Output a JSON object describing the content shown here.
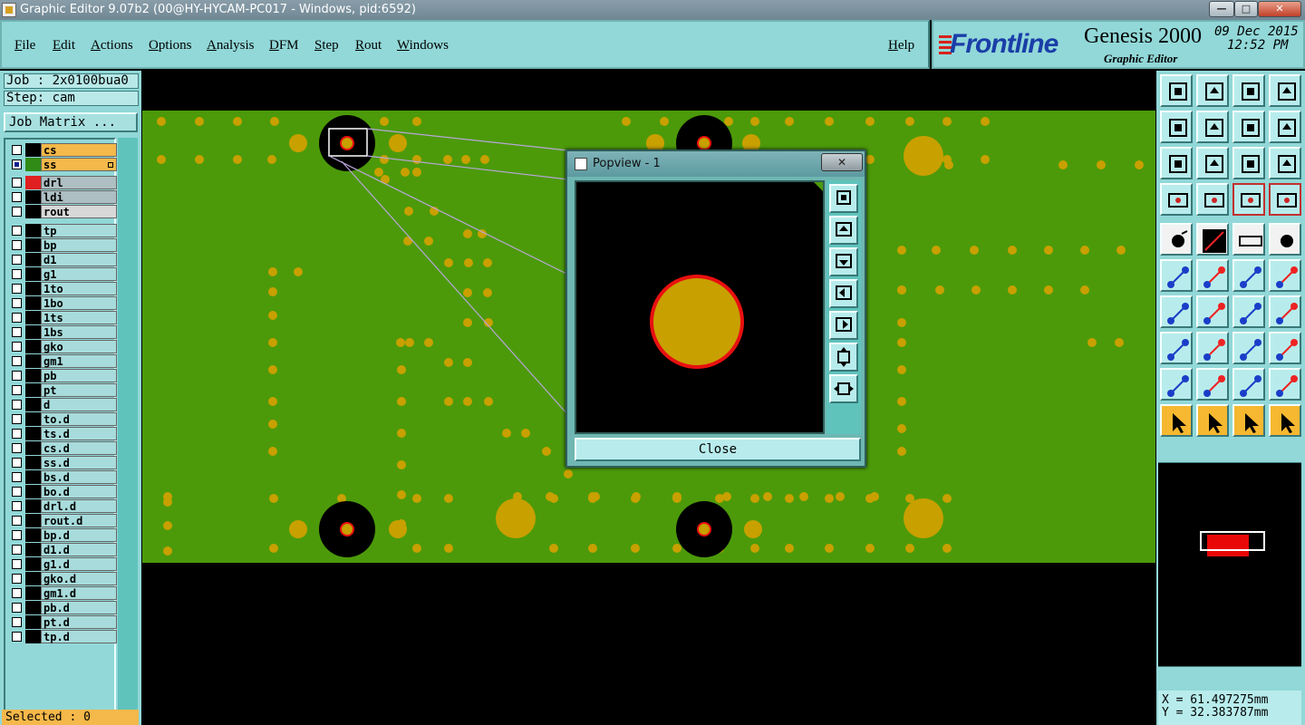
{
  "window": {
    "title": "Graphic Editor 9.07b2 (00@HY-HYCAM-PC017 - Windows, pid:6592)",
    "min_glyph": "—",
    "max_glyph": "□",
    "close_glyph": "✕"
  },
  "menu": {
    "items": [
      "File",
      "Edit",
      "Actions",
      "Options",
      "Analysis",
      "DFM",
      "Step",
      "Rout",
      "Windows"
    ],
    "help": "Help"
  },
  "branding": {
    "brand": "Frontline",
    "product": "Genesis 2000",
    "subtitle": "Graphic Editor",
    "date": "09 Dec 2015",
    "time": "12:52 PM"
  },
  "left": {
    "job": "Job : 2x0100bua0",
    "step": "Step: cam",
    "job_matrix": "Job Matrix ...",
    "selected": "Selected : 0",
    "layers": [
      {
        "name": "cs",
        "color": "#000000",
        "bg": "#f5b84a",
        "checked": false
      },
      {
        "name": "ss",
        "color": "#2f8a16",
        "bg": "#f5b84a",
        "checked": true,
        "marker": true
      },
      {
        "name": "drl",
        "color": "#e02020",
        "bg": "#aebfc4",
        "checked": false
      },
      {
        "name": "ldi",
        "color": "#000000",
        "bg": "#aebfc4",
        "checked": false
      },
      {
        "name": "rout",
        "color": "#000000",
        "bg": "#d8d8d8",
        "checked": false
      },
      {
        "name": "tp"
      },
      {
        "name": "bp"
      },
      {
        "name": "d1"
      },
      {
        "name": "g1"
      },
      {
        "name": "1to"
      },
      {
        "name": "1bo"
      },
      {
        "name": "1ts"
      },
      {
        "name": "1bs"
      },
      {
        "name": "gko"
      },
      {
        "name": "gm1"
      },
      {
        "name": "pb"
      },
      {
        "name": "pt"
      },
      {
        "name": "d"
      },
      {
        "name": "to.d"
      },
      {
        "name": "ts.d"
      },
      {
        "name": "cs.d"
      },
      {
        "name": "ss.d"
      },
      {
        "name": "bs.d"
      },
      {
        "name": "bo.d"
      },
      {
        "name": "drl.d"
      },
      {
        "name": "rout.d"
      },
      {
        "name": "bp.d"
      },
      {
        "name": "d1.d"
      },
      {
        "name": "g1.d"
      },
      {
        "name": "gko.d"
      },
      {
        "name": "gm1.d"
      },
      {
        "name": "pb.d"
      },
      {
        "name": "pt.d"
      },
      {
        "name": "tp.d"
      }
    ]
  },
  "popview": {
    "title": "Popview - 1",
    "close_glyph": "✕",
    "close_label": "Close"
  },
  "status": {
    "x": "X = 61.497275mm",
    "y": "Y = 32.383787mm"
  },
  "colors": {
    "board": "#4c9a0a",
    "pad": "#c8a000",
    "pad_highlight": "#e81010",
    "panel": "#92d8d8"
  },
  "toolbar_icons": [
    "zoom-home-icon",
    "zoom-in-icon",
    "zoom-page-icon",
    "zoom-window-icon",
    "pan-left-icon",
    "pan-right-icon",
    "mirror-icon",
    "snap-icon",
    "fit-icon",
    "center-icon",
    "scale-1-2-icon",
    "help-icon",
    "measure-icon",
    "probe-icon",
    "layer-toggle-icon",
    "layer-display-icon",
    "pad-icon",
    "line-icon",
    "ruler-icon",
    "circle-icon",
    "connect-icon",
    "delete-icon",
    "move-icon",
    "copy-icon",
    "angle-icon",
    "slope-icon",
    "rotate-icon",
    "spacing-icon",
    "select-icon",
    "break-icon",
    "resize-icon",
    "group-icon",
    "arc-icon",
    "arc2-icon",
    "arc3-icon",
    "arc4-icon",
    "pointer-icon",
    "select-box-icon",
    "select-circle-icon",
    "select-path-icon"
  ]
}
